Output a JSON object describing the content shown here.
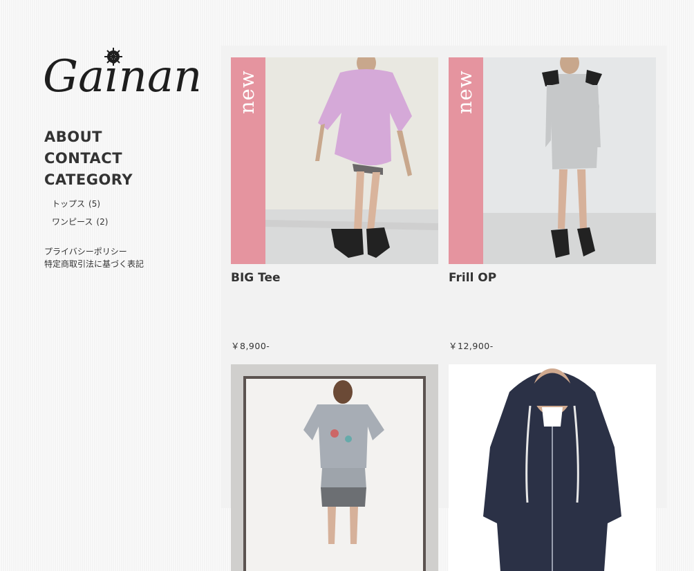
{
  "brand": {
    "logo_text": "Gainan"
  },
  "nav": {
    "about": "ABOUT",
    "contact": "CONTACT",
    "category": "CATEGORY",
    "categories": [
      {
        "label": "トップス",
        "count": "(5)"
      },
      {
        "label": "ワンピース",
        "count": "(2)"
      }
    ]
  },
  "footer_links": {
    "privacy": "プライバシーポリシー",
    "legal": "特定商取引法に基づく表記"
  },
  "products": [
    {
      "name": "BIG Tee",
      "price": "￥8,900-",
      "badge": "new"
    },
    {
      "name": "Frill OP",
      "price": "￥12,900-",
      "badge": "new"
    },
    {
      "name": "",
      "price": "",
      "badge": ""
    },
    {
      "name": "",
      "price": "",
      "badge": ""
    }
  ],
  "colors": {
    "badge": "#e5949f",
    "text": "#333333",
    "panel": "#f2f2f2"
  }
}
